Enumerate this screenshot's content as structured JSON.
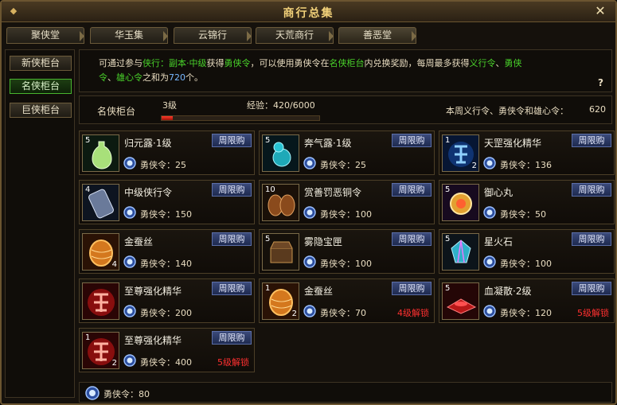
{
  "window": {
    "title": "商行总集"
  },
  "tabs": [
    {
      "label": "聚侠堂"
    },
    {
      "label": "华玉集"
    },
    {
      "label": "云锦行"
    },
    {
      "label": "天荒商行"
    },
    {
      "label": "善恶堂"
    }
  ],
  "sidebar": {
    "items": [
      {
        "label": "新侠柜台"
      },
      {
        "label": "名侠柜台"
      },
      {
        "label": "巨侠柜台"
      }
    ],
    "active_index": 1
  },
  "info": {
    "p1": "可通过参与",
    "p2": "侠行：副本·中级",
    "p3": "获得",
    "p4": "勇侠令",
    "p5": "，可以使用勇侠令在",
    "p6": "名侠柜台",
    "p7": "内兑换奖励，每周最多获得",
    "p8": "义行令",
    "p9": "、",
    "p10": "勇侠",
    "p11": "令",
    "p12": "、",
    "p13": "雄心令",
    "p14": "之和为",
    "p15": "720",
    "p16": "个。",
    "help": "?"
  },
  "progress": {
    "counter_name": "名侠柜台",
    "level": "3级",
    "exp_label": "经验：420/6000",
    "exp_current": 420,
    "exp_max": 6000,
    "weekly_label": "本周义行令、勇侠令和雄心令：",
    "weekly_value": "620"
  },
  "currency_name": "勇侠令：",
  "limit_label": "周限购",
  "items": [
    {
      "name": "归元露·1级",
      "count": "5",
      "price": "25",
      "unlock": "",
      "icon": "green-bottle-icon"
    },
    {
      "name": "奔气露·1级",
      "count": "5",
      "price": "25",
      "unlock": "",
      "icon": "cyan-gourd-icon"
    },
    {
      "name": "天罡强化精华",
      "count": "1",
      "count2": "2",
      "price": "136",
      "unlock": "",
      "icon": "blue-rune-icon"
    },
    {
      "name": "中级侠行令",
      "count": "4",
      "price": "150",
      "unlock": "",
      "icon": "token-icon"
    },
    {
      "name": "赏善罚恶铜令",
      "count": "10",
      "price": "100",
      "unlock": "",
      "icon": "bronze-token-icon"
    },
    {
      "name": "御心丸",
      "count": "5",
      "price": "50",
      "unlock": "",
      "icon": "pill-icon"
    },
    {
      "name": "金蚕丝",
      "count": "",
      "count2": "4",
      "price": "140",
      "unlock": "",
      "icon": "silk-icon"
    },
    {
      "name": "雾隐宝匣",
      "count": "5",
      "price": "100",
      "unlock": "",
      "icon": "chest-icon"
    },
    {
      "name": "星火石",
      "count": "5",
      "price": "100",
      "unlock": "",
      "icon": "gem-icon"
    },
    {
      "name": "至尊强化精华",
      "count": "",
      "price": "200",
      "unlock": "",
      "icon": "red-rune-icon"
    },
    {
      "name": "金蚕丝",
      "count": "1",
      "count2": "2",
      "price": "70",
      "unlock": "4级解锁",
      "icon": "silk-icon"
    },
    {
      "name": "血凝散·2级",
      "count": "5",
      "price": "120",
      "unlock": "5级解锁",
      "icon": "red-powder-icon"
    },
    {
      "name": "至尊强化精华",
      "count": "1",
      "count2": "2",
      "price": "400",
      "unlock": "5级解锁",
      "icon": "red-rune-icon"
    }
  ],
  "footer": {
    "label": "勇侠令：80"
  },
  "colors": {
    "accent_green": "#49d22a",
    "link_blue": "#78b8ff",
    "unlock_red": "#ff3030",
    "title_gold": "#f3d27a"
  }
}
